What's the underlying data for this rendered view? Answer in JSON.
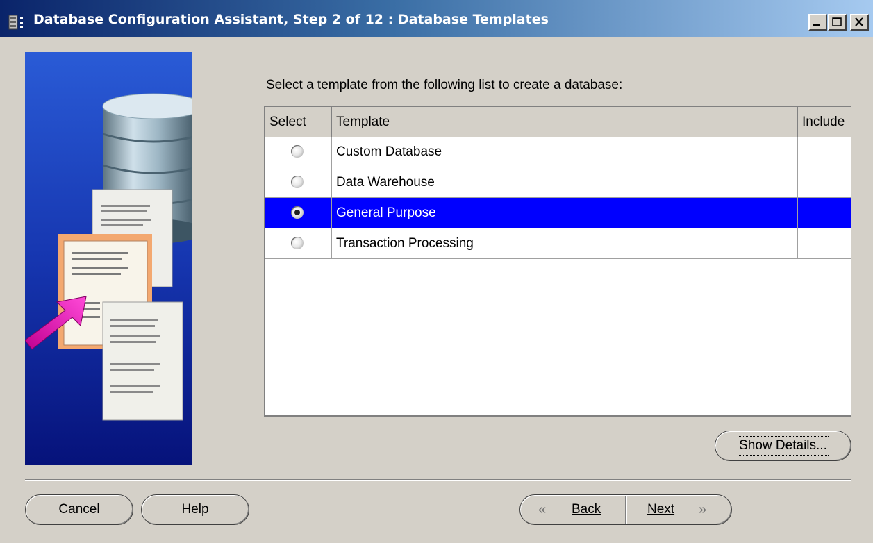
{
  "window": {
    "title": "Database Configuration Assistant, Step 2 of 12 : Database Templates",
    "controls": [
      "minimize-icon",
      "maximize-icon",
      "close-icon"
    ]
  },
  "main": {
    "prompt": "Select a template from the following list to create a database:",
    "table": {
      "columns": [
        "Select",
        "Template",
        "Include"
      ],
      "rows": [
        {
          "template": "Custom Database",
          "selected": false
        },
        {
          "template": "Data Warehouse",
          "selected": false
        },
        {
          "template": "General Purpose",
          "selected": true
        },
        {
          "template": "Transaction Processing",
          "selected": false
        }
      ]
    },
    "show_details_label": "Show Details..."
  },
  "footer": {
    "cancel_label": "Cancel",
    "help_label": "Help",
    "back_label": "Back",
    "next_label": "Next"
  },
  "colors": {
    "selection": "#0000ff",
    "dialog_bg": "#d4d0c8",
    "titlebar_start": "#0a246a"
  }
}
